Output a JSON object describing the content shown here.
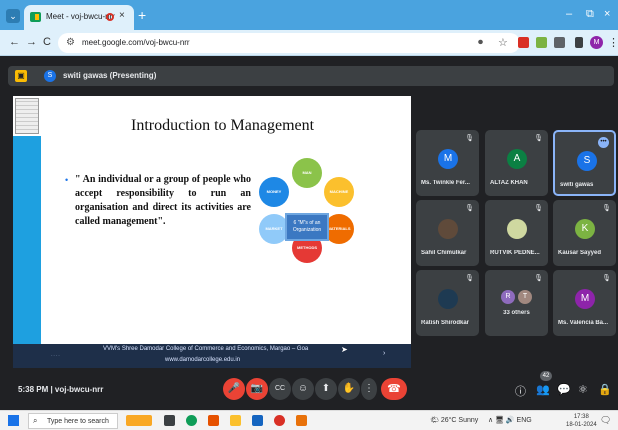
{
  "browser": {
    "tab_title": "Meet - voj-bwcu-nrr",
    "tab_close": "×",
    "new_tab": "+",
    "tab_list": "⌄",
    "minimize": "–",
    "restore": "⧉",
    "close": "×",
    "back": "←",
    "forward": "→",
    "reload": "C",
    "url": "meet.google.com/voj-bwcu-nrr",
    "site_info": "⚙",
    "mic_icon": "⏺",
    "star_icon": "☆",
    "profile_initial": "M"
  },
  "meet": {
    "presenting_label": "switi gawas (Presenting)",
    "presenter_initial": "S",
    "slide": {
      "title": "Introduction to Management",
      "bullet": "•",
      "body": "\" An individual or a group of people who accept responsibility to run an organisation and direct its activities are called management\".",
      "center_label": "6 \"M\"s of an Organization",
      "petals": [
        "MAN",
        "MACHINE",
        "MATERIALS",
        "METHODS",
        "MARKET",
        "MONEY"
      ],
      "footer_line1": "VVM's Shree Damodar College of Commerce and Economics, Margao – Goa",
      "footer_line2": "www.damodarcollege.edu.in",
      "footer_left": "- -  - -",
      "footer_right": "›"
    },
    "participants": [
      {
        "initial": "M",
        "name": "Ms. Twinkle Fer...",
        "color": "#1a73e8",
        "muted": true
      },
      {
        "initial": "A",
        "name": "ALTAZ KHAN",
        "color": "#0b8043",
        "muted": true
      },
      {
        "initial": "S",
        "name": "switi gawas",
        "color": "#1a73e8",
        "muted": false,
        "active": true,
        "more": "•••"
      },
      {
        "initial": "",
        "name": "Sahil Chimulkar",
        "color": "#5f4a3a",
        "muted": true
      },
      {
        "initial": "",
        "name": "RUTVIK PEDNE...",
        "color": "#cfd8a0",
        "muted": true
      },
      {
        "initial": "K",
        "name": "Kausar Sayyed",
        "color": "#7cb342",
        "muted": true
      },
      {
        "initial": "",
        "name": "Ratish Shirodkar",
        "color": "#1e3a52",
        "muted": true
      },
      {
        "initial": "R",
        "name": "33 others",
        "color": "#8e6bbd",
        "muted": true,
        "extra_initial": "T"
      },
      {
        "initial": "M",
        "name": "Ms. Valencia Ba...",
        "color": "#8e24aa",
        "muted": true
      }
    ],
    "mute_icon": "🎙",
    "controls": {
      "time_code": "5:38 PM  |  voj-bwcu-nrr",
      "mic": "🎤",
      "camera": "📷",
      "captions": "CC",
      "emoji": "☺",
      "present": "⬆",
      "raise_hand": "✋",
      "more": "⋮",
      "hangup": "☎",
      "info": "ⓘ",
      "people": "👥",
      "people_count": "42",
      "chat": "💬",
      "activities": "⚛",
      "host": "🔒"
    }
  },
  "taskbar": {
    "search_placeholder": "Type here to search",
    "search_icon": "⌕",
    "weather": "🌤 26°C  Sunny",
    "tray": "∧  🖥  🔊  ENG",
    "time": "17:38",
    "date": "18-01-2024",
    "notifications": "🗨"
  },
  "colors": {
    "browser_accent": "#4aa3df",
    "meet_bg": "#202124",
    "hangup_red": "#ea4335",
    "slide_blue": "#1ea0e0"
  }
}
